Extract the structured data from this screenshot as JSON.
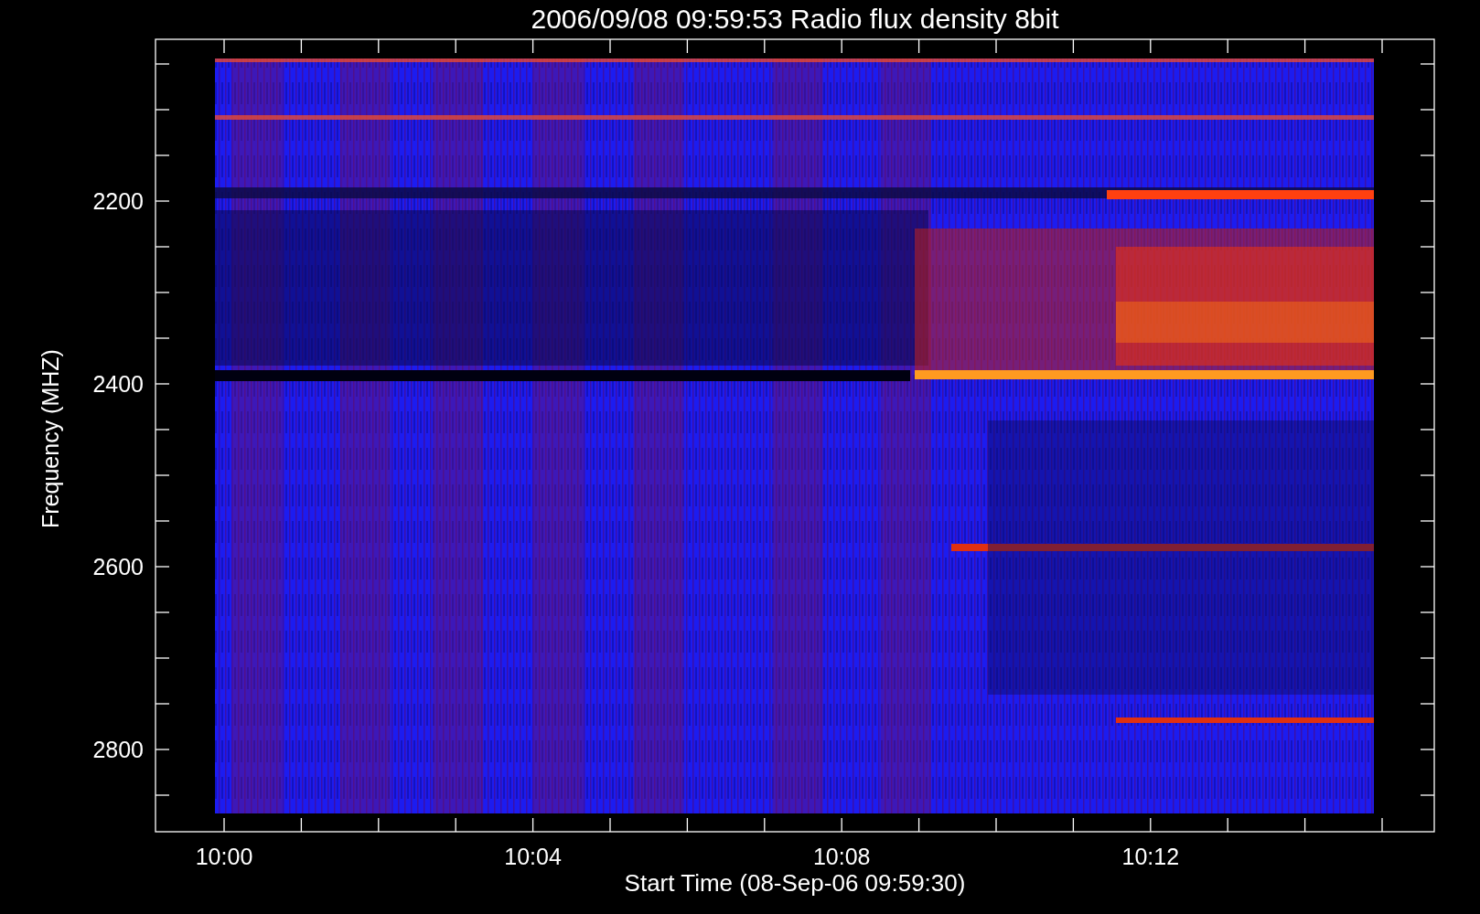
{
  "title": "2006/09/08 09:59:53 Radio flux density 8bit",
  "y_axis": {
    "label": "Frequency (MHZ)",
    "ticks": [
      "2200",
      "2400",
      "2600",
      "2800"
    ]
  },
  "x_axis": {
    "label": "Start Time (08-Sep-06 09:59:30)",
    "ticks": [
      "10:00",
      "10:04",
      "10:08",
      "10:12"
    ]
  }
}
